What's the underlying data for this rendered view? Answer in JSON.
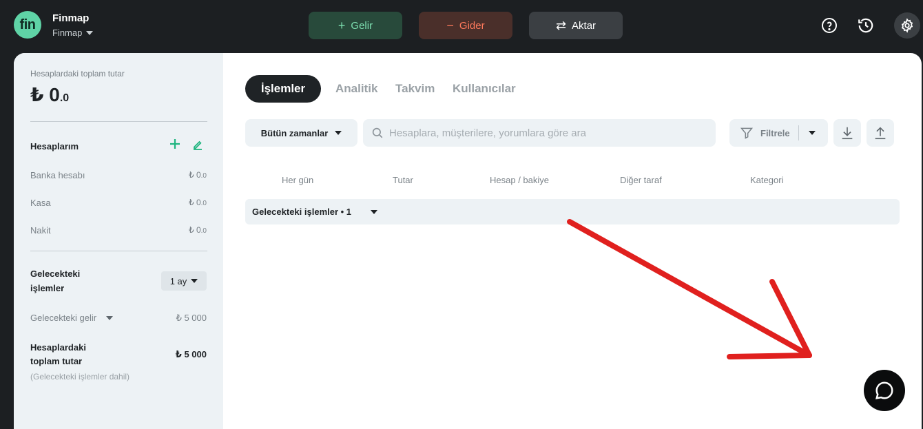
{
  "header": {
    "logo_text": "fin",
    "brand_title": "Finmap",
    "brand_sub": "Finmap",
    "income_label": "Gelir",
    "expense_label": "Gider",
    "transfer_label": "Aktar",
    "icons": [
      "help-icon",
      "history-icon",
      "gear-icon"
    ]
  },
  "sidebar": {
    "total_label": "Hesaplardaki toplam tutar",
    "total_int": "₺ 0",
    "total_dec": ".0",
    "accounts_title": "Hesaplarım",
    "accounts": [
      {
        "name": "Banka hesabı",
        "value": "₺ 0",
        "dec": ".0"
      },
      {
        "name": "Kasa",
        "value": "₺ 0",
        "dec": ".0"
      },
      {
        "name": "Nakit",
        "value": "₺ 0",
        "dec": ".0"
      }
    ],
    "future_title_1": "Gelecekteki",
    "future_title_2": "işlemler",
    "period": "1 ay",
    "future_income_label": "Gelecekteki gelir",
    "future_income_value": "₺ 5 000",
    "future_total_1": "Hesaplardaki",
    "future_total_2": "toplam tutar",
    "future_total_value": "₺ 5 000",
    "future_total_note": "(Gelecekteki işlemler dahil)"
  },
  "tabs": [
    "İşlemler",
    "Analitik",
    "Takvim",
    "Kullanıcılar"
  ],
  "toolbar": {
    "time_filter": "Bütün zamanlar",
    "search_placeholder": "Hesaplara, müşterilere, yorumlara göre ara",
    "filter_label": "Filtrele"
  },
  "table": {
    "columns": [
      "Her gün",
      "Tutar",
      "Hesap / bakiye",
      "Diğer taraf",
      "Kategori"
    ],
    "future_row": "Gelecekteki işlemler • 1"
  },
  "colors": {
    "accent_green": "#5fd3a6",
    "expense_red": "#ff7a5c",
    "annotation_arrow": "#e0201e"
  }
}
